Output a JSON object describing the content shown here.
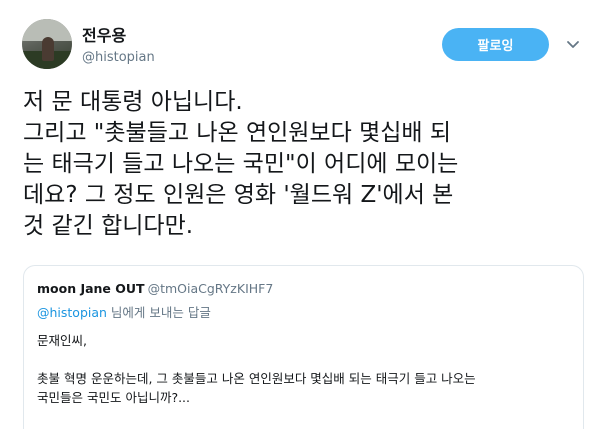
{
  "author": {
    "name": "전우용",
    "handle": "@histopian"
  },
  "follow_label": "팔로잉",
  "tweet_lines": [
    "저 문 대통령 아닙니다.",
    "그리고 \"촛불들고 나온 연인원보다 몇십배 되",
    "는 태극기 들고 나오는 국민\"이 어디에 모이는",
    "데요? 그 정도 인원은 영화 '월드워 Z'에서 본",
    "것 같긴 합니다만."
  ],
  "quoted": {
    "name": "moon Jane OUT",
    "handle": "@tmOiaCgRYzKIHF7",
    "reply_to_mention": "@histopian",
    "reply_suffix": " 님에게 보내는 답글",
    "body_lines": [
      "문재인씨,",
      "",
      "촛불 혁명 운운하는데,  그 촛불들고 나온 연인원보다 몇십배  되는 태극기 들고 나오는",
      "국민들은 국민도 아닙니까?..."
    ]
  },
  "colors": {
    "follow_button": "#4ab3f4",
    "link": "#1b95e0",
    "secondary_text": "#657786",
    "border": "#e1e8ed"
  },
  "icons": [
    "chevron-down-icon"
  ]
}
